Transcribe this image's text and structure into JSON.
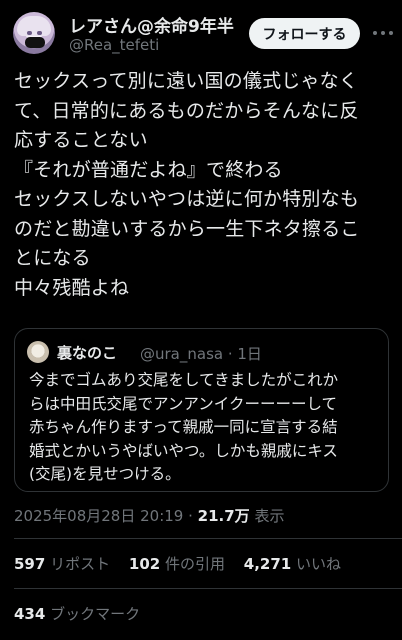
{
  "author": {
    "name": "レアさん@余命9年半",
    "handle": "@Rea_tefeti",
    "follow_label": "フォローする"
  },
  "tweet": {
    "lines": [
      "セックスって別に遠い国の儀式じゃなく",
      "て、日常的にあるものだからそんなに反",
      "応することない",
      "『それが普通だよね』で終わる",
      "セックスしないやつは逆に何か特別なも",
      "のだと勘違いするから一生下ネタ擦るこ",
      "とになる",
      "中々残酷よね"
    ]
  },
  "quote": {
    "name": "裏なのこ",
    "handle": "@ura_nasa · 1日",
    "lines": [
      "今までゴムあり交尾をしてきましたがこれか",
      "らは中田氏交尾でアンアンイクーーーーして",
      "赤ちゃん作りますって親戚一同に宣言する結",
      "婚式とかいうやばいやつ。しかも親戚にキス",
      "(交尾)を見せつける。"
    ]
  },
  "meta": {
    "datetime": "2025年08月28日 20:19 · ",
    "views": "21.7万",
    "views_label": " 表示"
  },
  "stats": {
    "reposts": "597",
    "reposts_label": "リポスト",
    "quotes": "102",
    "quotes_label": "件の引用",
    "likes": "4,271",
    "likes_label": "いいね",
    "bookmarks": "434",
    "bookmarks_label": "ブックマーク"
  }
}
